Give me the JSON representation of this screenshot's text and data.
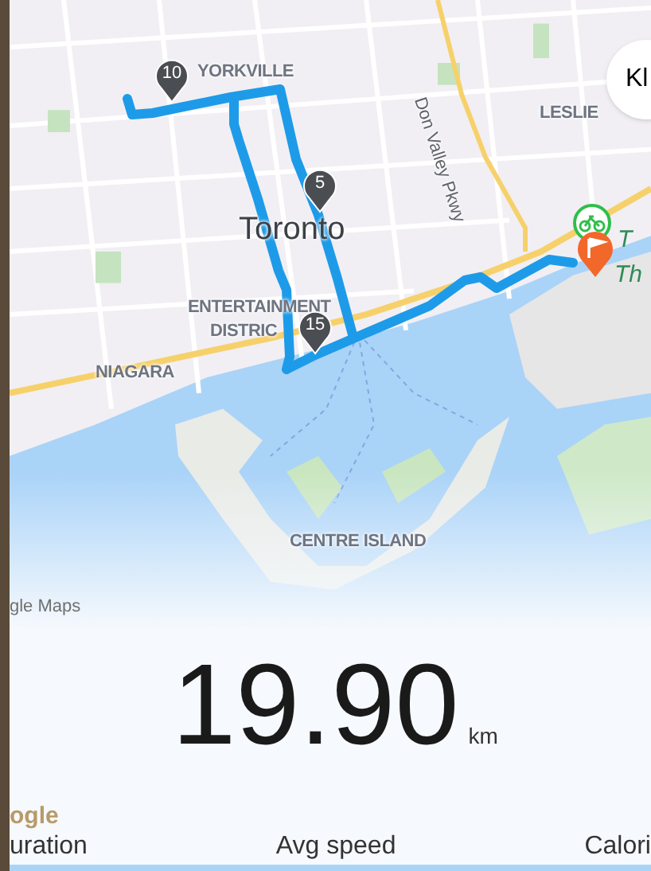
{
  "map": {
    "labels": [
      {
        "text": "YORKVILLE",
        "kind": "district"
      },
      {
        "text": "Don Valley Pkwy",
        "kind": "road"
      },
      {
        "text": "LESLIE",
        "kind": "district"
      },
      {
        "text": "Toronto",
        "kind": "city"
      },
      {
        "text": "T",
        "kind": "park"
      },
      {
        "text": "Th",
        "kind": "park"
      },
      {
        "text": "ENTERTAINMENT",
        "kind": "district"
      },
      {
        "text": "DISTRIC",
        "kind": "district"
      },
      {
        "text": "NIAGARA",
        "kind": "district"
      },
      {
        "text": "CENTRE ISLAND",
        "kind": "district"
      }
    ],
    "markers": [
      {
        "label": "10"
      },
      {
        "label": "5"
      },
      {
        "label": "15"
      }
    ],
    "place_chip": "Kl",
    "attribution": "gle Maps",
    "logo": "ogle"
  },
  "distance": {
    "value": "19.90",
    "unit": "km"
  },
  "stats": [
    "uration",
    "Avg speed",
    "Calori"
  ]
}
